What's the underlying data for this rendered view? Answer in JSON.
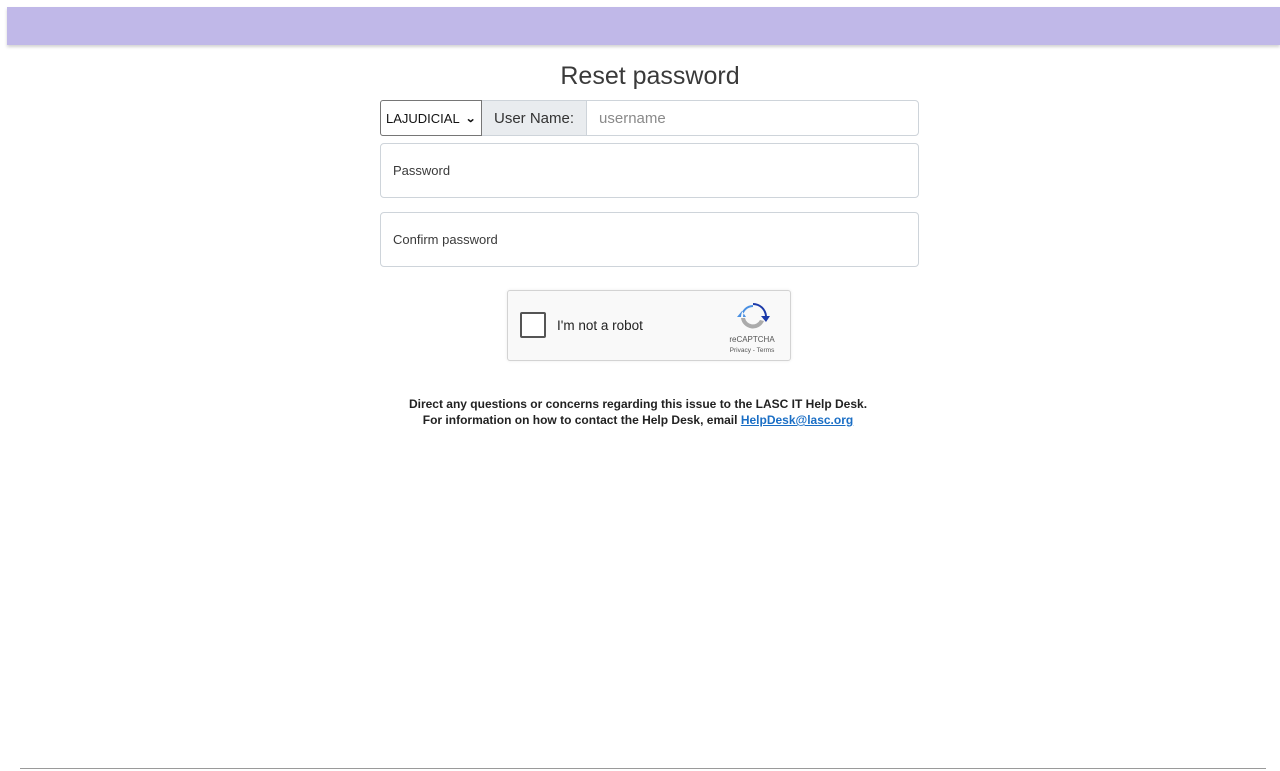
{
  "header": {
    "bar_color": "#c0b8e8"
  },
  "title": "Reset password",
  "username_row": {
    "domain_selected": "LAJUDICIAL",
    "label": "User Name:",
    "placeholder": "username"
  },
  "password": {
    "placeholder": "Password"
  },
  "confirm": {
    "placeholder": "Confirm password"
  },
  "captcha": {
    "label": "I'm not a robot",
    "brand": "reCAPTCHA",
    "links": "Privacy - Terms"
  },
  "help": {
    "line1": "Direct any questions or concerns regarding this issue to the LASC IT Help Desk.",
    "line2_prefix": "For information on how to contact the Help Desk, email",
    "email": "HelpDesk@lasc.org"
  }
}
